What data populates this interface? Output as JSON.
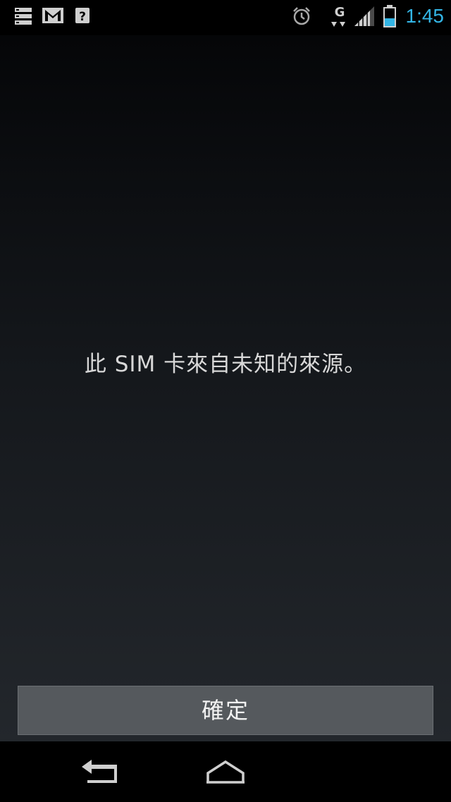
{
  "status_bar": {
    "time": "1:45",
    "network_type": "G",
    "icons": [
      "storage-icon",
      "gmail-icon",
      "unknown-notification-icon",
      "alarm-icon",
      "data-activity-icon",
      "signal-icon",
      "battery-icon"
    ],
    "accent_color": "#33b5e5"
  },
  "dialog": {
    "message": "此 SIM 卡來自未知的來源。",
    "ok_label": "確定"
  },
  "nav_bar": {
    "buttons": [
      "back-icon",
      "home-icon"
    ]
  }
}
